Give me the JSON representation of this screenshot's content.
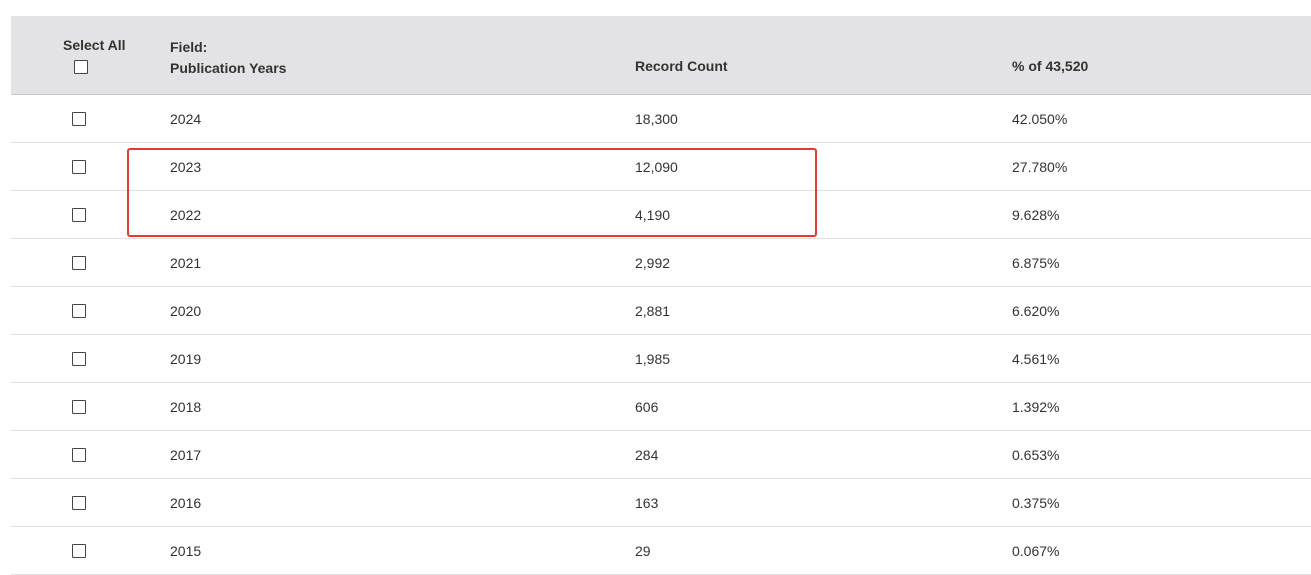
{
  "header": {
    "select_all_label": "Select All",
    "field_label": "Field:",
    "field_name": "Publication Years",
    "record_count_label": "Record Count",
    "percent_label": "% of 43,520"
  },
  "rows": [
    {
      "year": "2024",
      "count": "18,300",
      "percent": "42.050%"
    },
    {
      "year": "2023",
      "count": "12,090",
      "percent": "27.780%"
    },
    {
      "year": "2022",
      "count": "4,190",
      "percent": "9.628%"
    },
    {
      "year": "2021",
      "count": "2,992",
      "percent": "6.875%"
    },
    {
      "year": "2020",
      "count": "2,881",
      "percent": "6.620%"
    },
    {
      "year": "2019",
      "count": "1,985",
      "percent": "4.561%"
    },
    {
      "year": "2018",
      "count": "606",
      "percent": "1.392%"
    },
    {
      "year": "2017",
      "count": "284",
      "percent": "0.653%"
    },
    {
      "year": "2016",
      "count": "163",
      "percent": "0.375%"
    },
    {
      "year": "2015",
      "count": "29",
      "percent": "0.067%"
    }
  ],
  "colors": {
    "header_bg": "#e3e3e5",
    "highlight": "#e53935",
    "text": "#333333"
  }
}
